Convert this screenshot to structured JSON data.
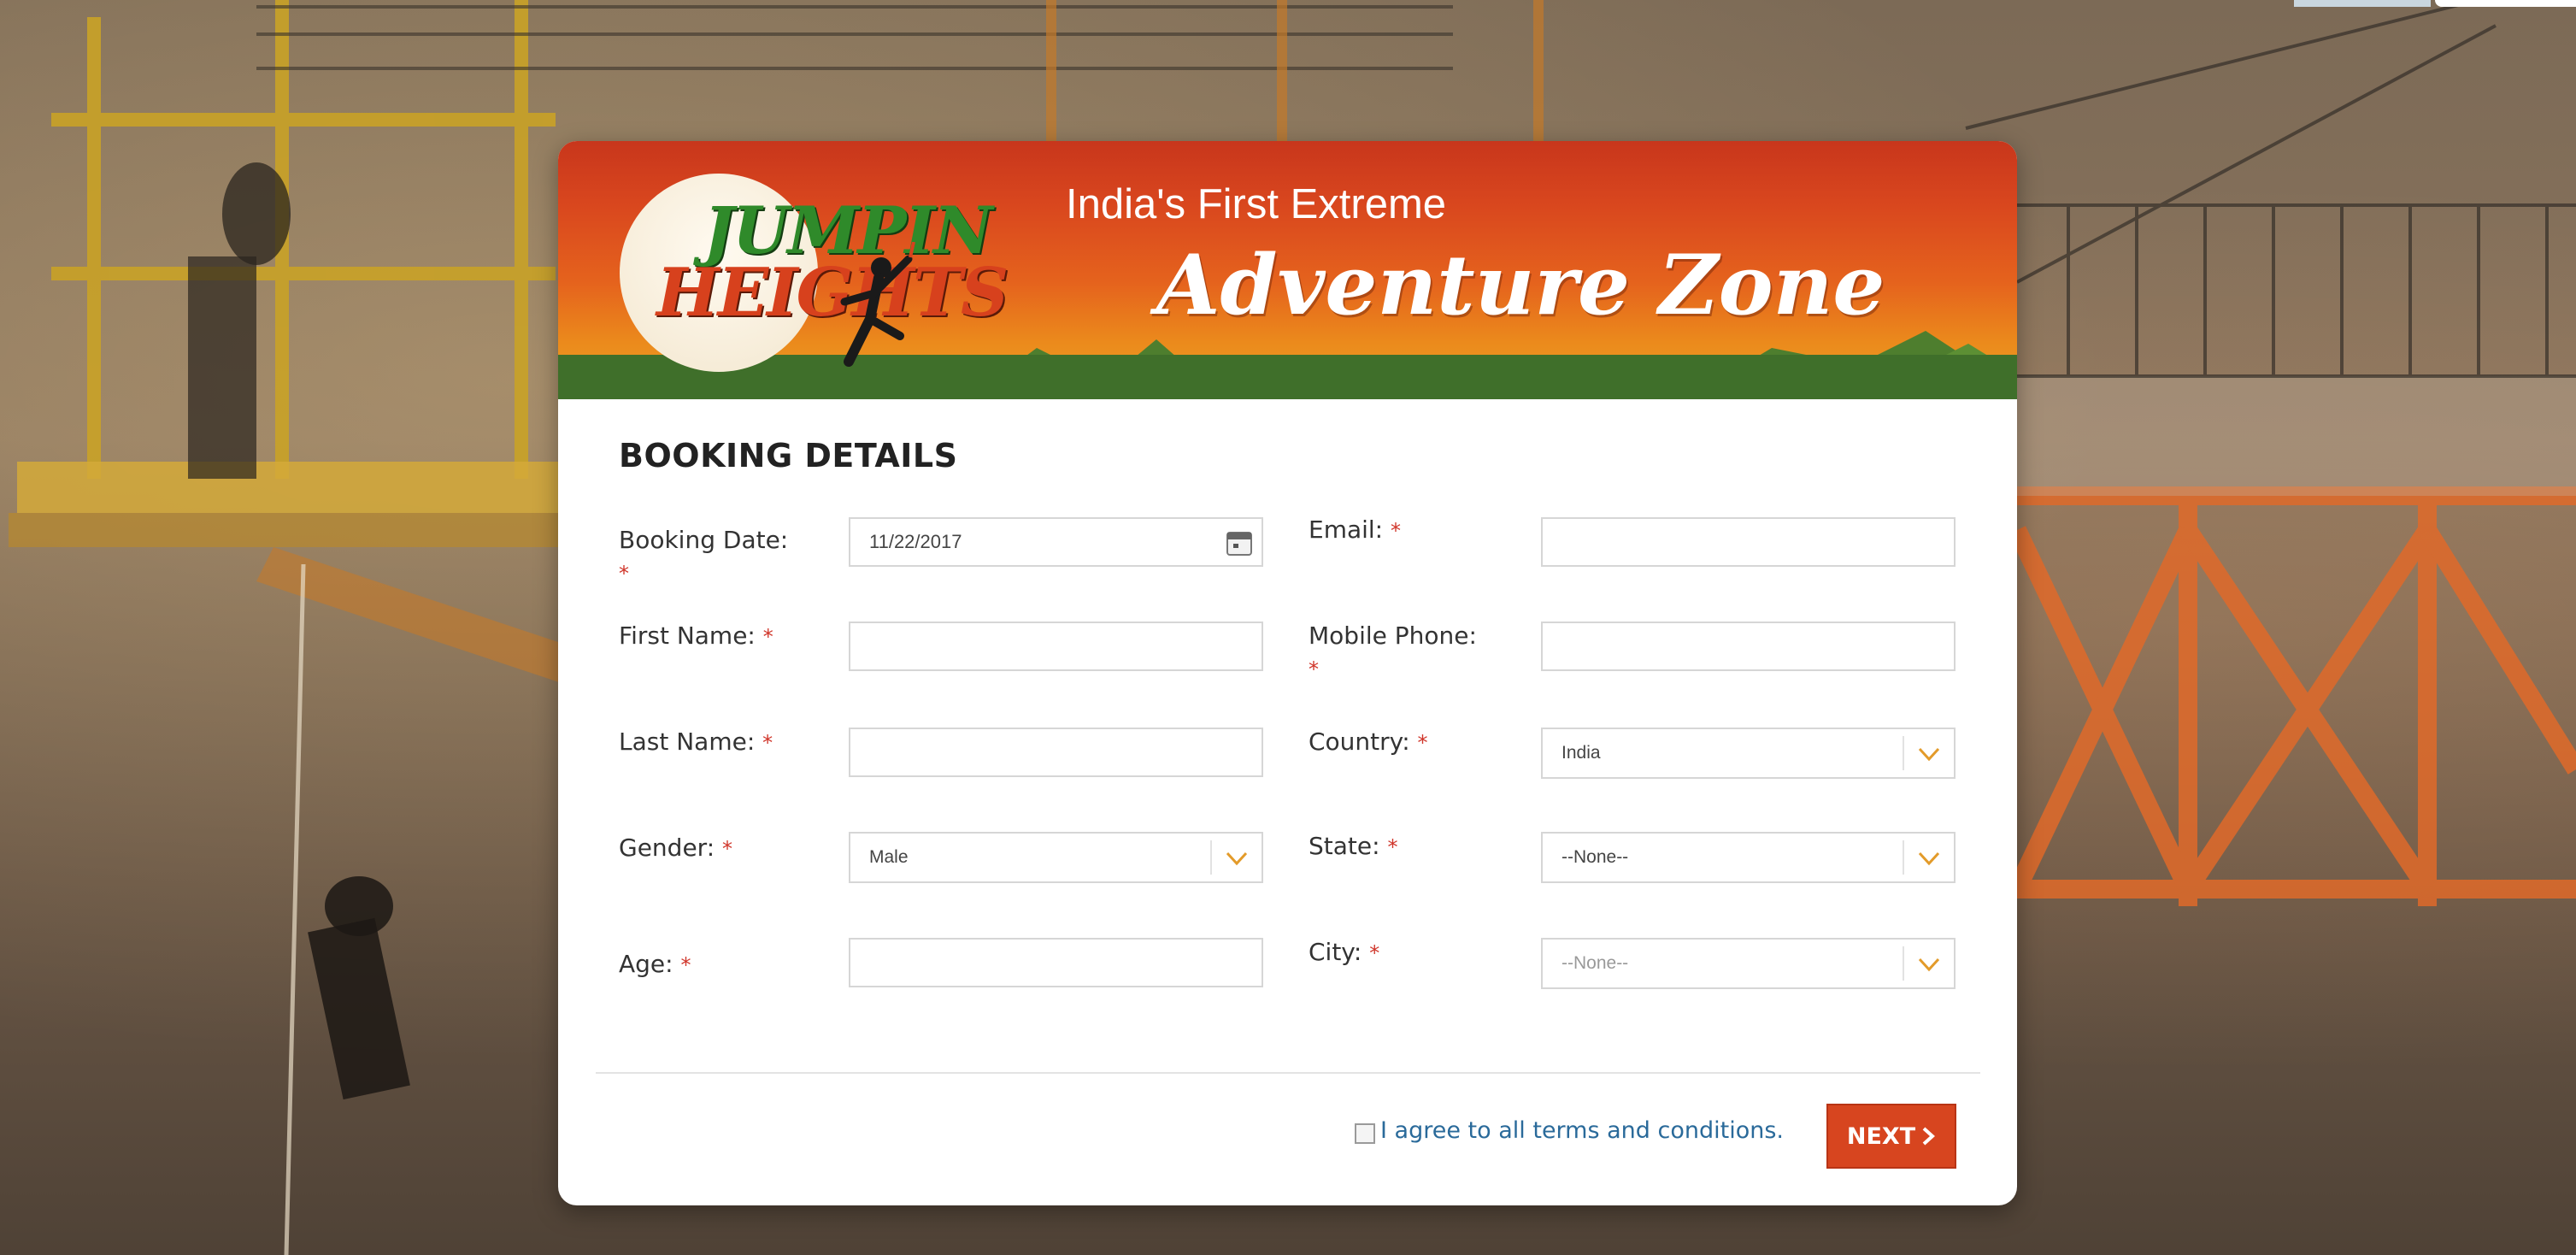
{
  "banner": {
    "logo_line1": "JUMPIN",
    "logo_line2": "HEIGHTS",
    "tagline_top": "India's First Extreme",
    "tagline_main": "Adventure Zone"
  },
  "form": {
    "title": "BOOKING DETAILS",
    "booking_date": {
      "label": "Booking Date:",
      "required": "*",
      "value": "11/22/2017"
    },
    "email": {
      "label": "Email:",
      "required": "*",
      "value": ""
    },
    "first_name": {
      "label": "First Name:",
      "required": "*",
      "value": ""
    },
    "mobile_phone": {
      "label": "Mobile Phone:",
      "required": "*",
      "value": ""
    },
    "last_name": {
      "label": "Last Name:",
      "required": "*",
      "value": ""
    },
    "country": {
      "label": "Country:",
      "required": "*",
      "selected": "India"
    },
    "gender": {
      "label": "Gender:",
      "required": "*",
      "selected": "Male"
    },
    "state": {
      "label": "State:",
      "required": "*",
      "selected": "--None--"
    },
    "age": {
      "label": "Age:",
      "required": "*",
      "value": ""
    },
    "city": {
      "label": "City:",
      "required": "*",
      "selected": "--None--"
    }
  },
  "footer": {
    "terms_label": "I agree to all terms and conditions.",
    "terms_checked": false,
    "next_label": "NEXT"
  },
  "colors": {
    "banner_red": "#c8361c",
    "banner_orange": "#eb8a1c",
    "banner_green": "#3f6f2a",
    "accent_button": "#d7451f",
    "required_mark": "#d0352a",
    "link_blue": "#2a6a9a"
  }
}
